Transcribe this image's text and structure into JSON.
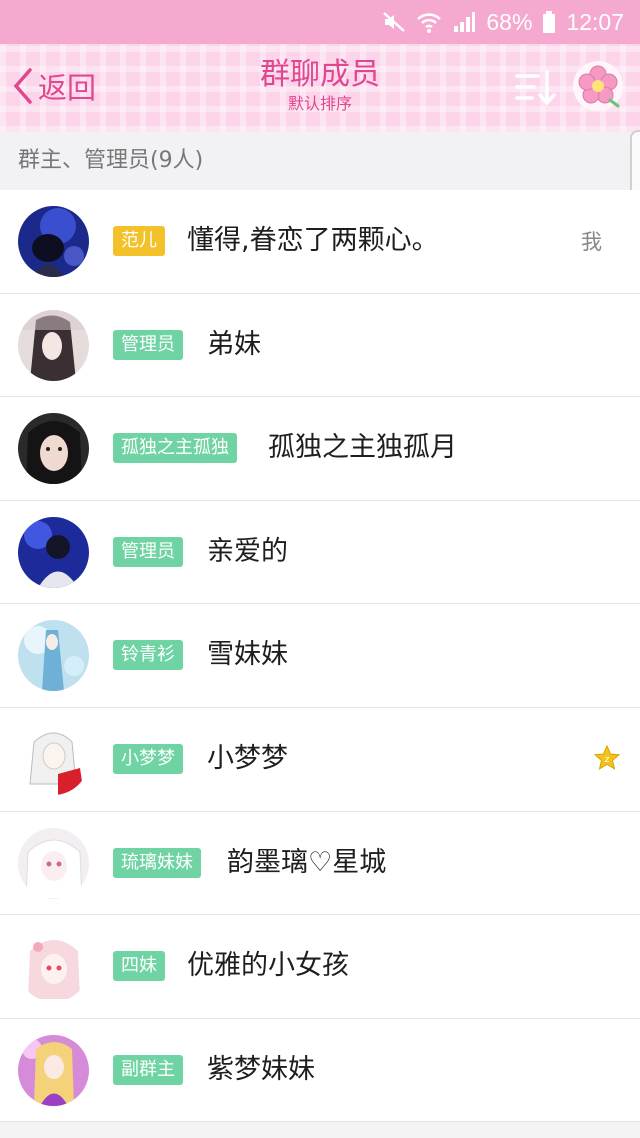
{
  "status": {
    "battery": "68%",
    "time": "12:07"
  },
  "header": {
    "back_label": "返回",
    "title": "群聊成员",
    "subtitle": "默认排序"
  },
  "section": {
    "title": "群主、管理员(9人)"
  },
  "members": [
    {
      "badge": "范儿",
      "badge_color": "#f3c12a",
      "name": "懂得,眷恋了两颗心。",
      "tag": "我"
    },
    {
      "badge": "管理员",
      "badge_color": "#6fd3a3",
      "name": "弟妹"
    },
    {
      "badge": "孤独之主孤独",
      "badge_color": "#6fd3a3",
      "name": "孤独之主独孤月"
    },
    {
      "badge": "管理员",
      "badge_color": "#6fd3a3",
      "name": "亲爱的"
    },
    {
      "badge": "铃青衫",
      "badge_color": "#6fd3a3",
      "name": "雪妹妹"
    },
    {
      "badge": "小梦梦",
      "badge_color": "#6fd3a3",
      "name": "小梦梦",
      "marker": "star-icon"
    },
    {
      "badge": "琉璃妹妹",
      "badge_color": "#6fd3a3",
      "name": "韵墨璃♡星城"
    },
    {
      "badge": "四妹",
      "badge_color": "#6fd3a3",
      "name": "优雅的小女孩"
    },
    {
      "badge": "副群主",
      "badge_color": "#6fd3a3",
      "name": "紫梦妹妹"
    }
  ],
  "colors": {
    "accent": "#e0478e",
    "status_bar": "#f6a9cf",
    "header_bg": "#fcd5ea",
    "badge_green": "#6fd3a3",
    "badge_yellow": "#f3c12a"
  }
}
